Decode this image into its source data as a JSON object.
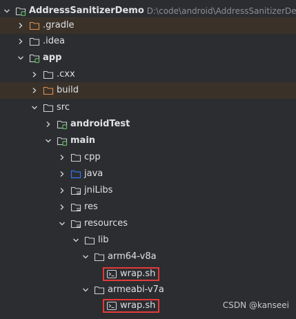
{
  "tree": {
    "root": {
      "label": "AddressSanitizerDemo",
      "path": "D:\\code\\android\\AddressSanitizerDemo"
    },
    "gradle": {
      "label": ".gradle"
    },
    "idea": {
      "label": ".idea"
    },
    "app": {
      "label": "app"
    },
    "cxx": {
      "label": ".cxx"
    },
    "build": {
      "label": "build"
    },
    "src": {
      "label": "src"
    },
    "androidTest": {
      "label": "androidTest"
    },
    "main": {
      "label": "main"
    },
    "cpp": {
      "label": "cpp"
    },
    "java": {
      "label": "java"
    },
    "jniLibs": {
      "label": "jniLibs"
    },
    "res": {
      "label": "res"
    },
    "resources": {
      "label": "resources"
    },
    "lib": {
      "label": "lib"
    },
    "arm64": {
      "label": "arm64-v8a"
    },
    "wrap1": {
      "label": "wrap.sh"
    },
    "armeabi": {
      "label": "armeabi-v7a"
    },
    "wrap2": {
      "label": "wrap.sh"
    }
  },
  "watermark": "CSDN @kanseei",
  "colors": {
    "background": "#2b2d30",
    "excluded_row": "#3a3129",
    "excluded_folder": "#e0b06b",
    "source_folder": "#3574f0",
    "module_marker": "#5fb865",
    "highlight_box": "#e53a3a"
  }
}
